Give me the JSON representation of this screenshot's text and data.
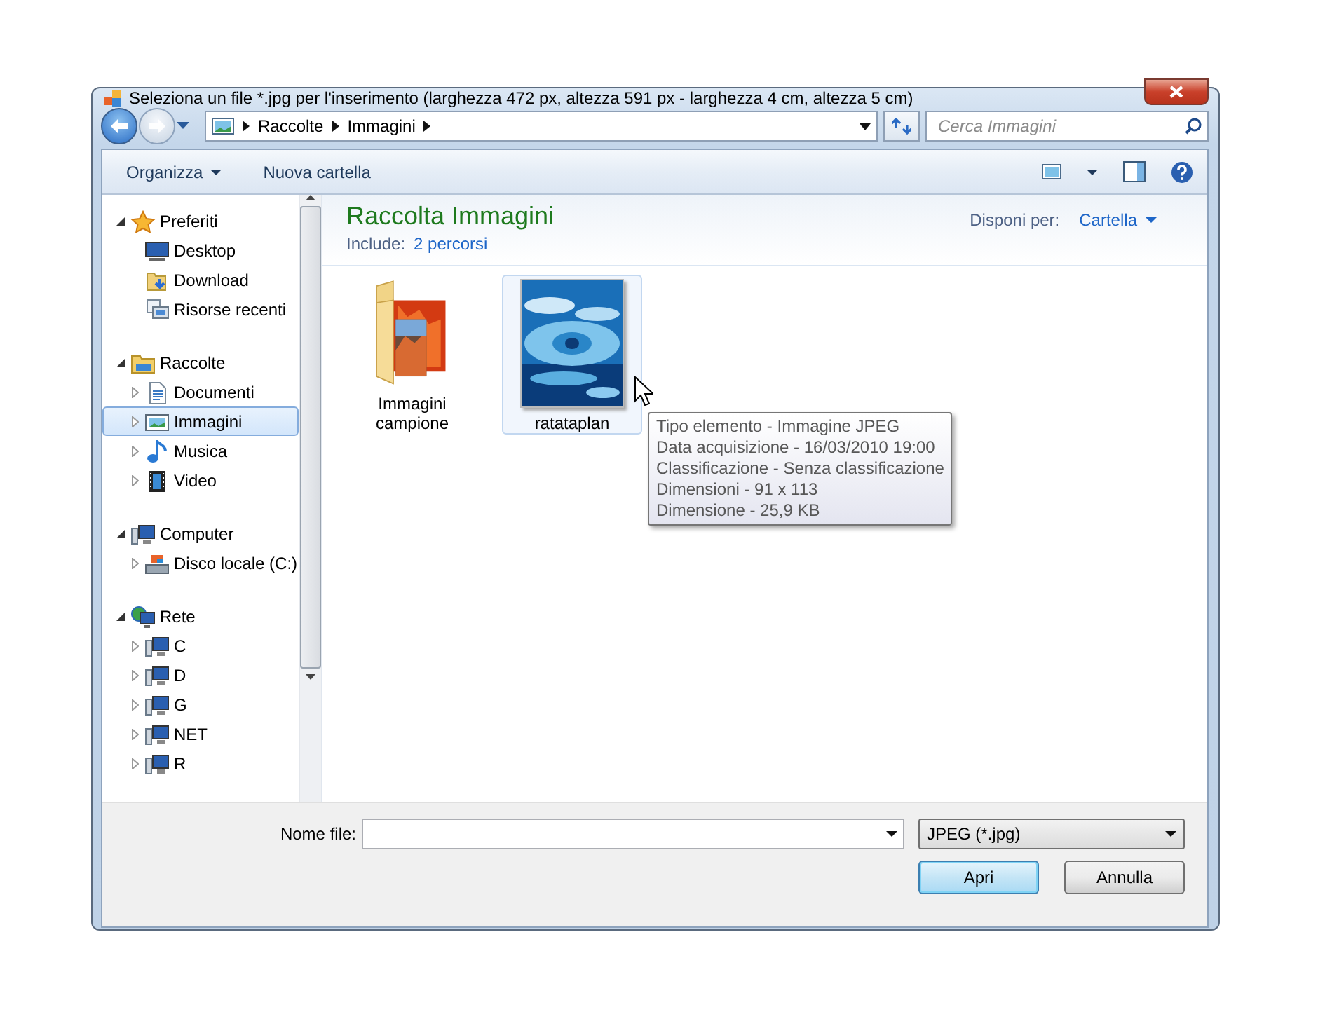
{
  "window": {
    "title": "Seleziona un file *.jpg per l'inserimento (larghezza 472 px, altezza 591 px - larghezza 4 cm, altezza 5 cm)"
  },
  "address": {
    "breadcrumb": [
      "Raccolte",
      "Immagini"
    ]
  },
  "search": {
    "placeholder": "Cerca Immagini"
  },
  "toolbar": {
    "organize": "Organizza",
    "new_folder": "Nuova cartella"
  },
  "nav": [
    {
      "label": "Preferiti",
      "kind": "favorites",
      "expanded": true,
      "selected": false,
      "children": [
        {
          "label": "Desktop",
          "kind": "desktop",
          "selected": false
        },
        {
          "label": "Download",
          "kind": "download",
          "selected": false
        },
        {
          "label": "Risorse recenti",
          "kind": "recent",
          "selected": false
        }
      ]
    },
    {
      "label": "Raccolte",
      "kind": "library",
      "expanded": true,
      "selected": false,
      "children": [
        {
          "label": "Documenti",
          "kind": "documents",
          "expanded": false,
          "selected": false
        },
        {
          "label": "Immagini",
          "kind": "pictures",
          "expanded": false,
          "selected": true
        },
        {
          "label": "Musica",
          "kind": "music",
          "expanded": false,
          "selected": false
        },
        {
          "label": "Video",
          "kind": "video",
          "expanded": false,
          "selected": false
        }
      ]
    },
    {
      "label": "Computer",
      "kind": "computer",
      "expanded": true,
      "selected": false,
      "children": [
        {
          "label": "Disco locale (C:)",
          "kind": "drive",
          "expanded": false,
          "selected": false
        }
      ]
    },
    {
      "label": "Rete",
      "kind": "network",
      "expanded": true,
      "selected": false,
      "children": [
        {
          "label": "C",
          "kind": "pc",
          "expanded": false,
          "selected": false
        },
        {
          "label": "D",
          "kind": "pc",
          "expanded": false,
          "selected": false
        },
        {
          "label": "G",
          "kind": "pc",
          "expanded": false,
          "selected": false
        },
        {
          "label": "NET",
          "kind": "pc",
          "expanded": false,
          "selected": false
        },
        {
          "label": "R",
          "kind": "pc",
          "expanded": false,
          "selected": false
        }
      ]
    }
  ],
  "library": {
    "title": "Raccolta Immagini",
    "include_label": "Include:",
    "include_link": "2 percorsi",
    "arrange_label": "Disponi per:",
    "arrange_value": "Cartella"
  },
  "items": [
    {
      "label": "Immagini campione",
      "kind": "folder",
      "selected": false
    },
    {
      "label": "ratataplan",
      "selected": true
    }
  ],
  "tooltip": [
    "Tipo elemento - Immagine JPEG",
    "Data acquisizione - 16/03/2010 19:00",
    "Classificazione - Senza classificazione",
    "Dimensioni - 91 x 113",
    "Dimensione - 25,9 KB"
  ],
  "bottom": {
    "filename_label": "Nome file:",
    "filter": "JPEG (*.jpg)",
    "buttons": [
      {
        "label": "Apri",
        "default": true
      },
      {
        "label": "Annulla",
        "default": false
      }
    ]
  }
}
